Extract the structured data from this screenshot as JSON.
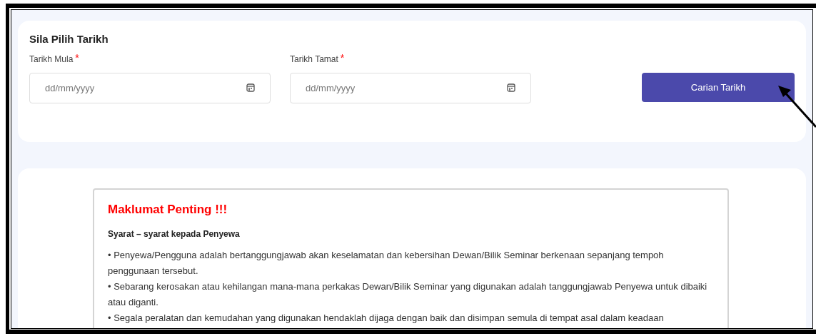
{
  "date_card": {
    "title": "Sila Pilih Tarikh",
    "fields": [
      {
        "label": "Tarikh Mula",
        "required_mark": "*",
        "placeholder": "dd/mm/yyyy"
      },
      {
        "label": "Tarikh Tamat",
        "required_mark": "*",
        "placeholder": "dd/mm/yyyy"
      }
    ],
    "button": "Carian Tarikh"
  },
  "notice": {
    "title": "Maklumat Penting !!!",
    "subtitle": "Syarat – syarat kepada Penyewa",
    "bullets": [
      "• Penyewa/Pengguna adalah bertanggungjawab akan keselamatan dan kebersihan Dewan/Bilik Seminar berkenaan sepanjang tempoh penggunaan tersebut.",
      "• Sebarang kerosakan atau kehilangan mana-mana perkakas Dewan/Bilik Seminar yang digunakan adalah tanggungjawab Penyewa untuk dibaiki atau diganti.",
      "• Segala peralatan dan kemudahan yang digunakan hendaklah dijaga dengan baik dan disimpan semula di tempat asal dalam keadaan"
    ]
  }
}
